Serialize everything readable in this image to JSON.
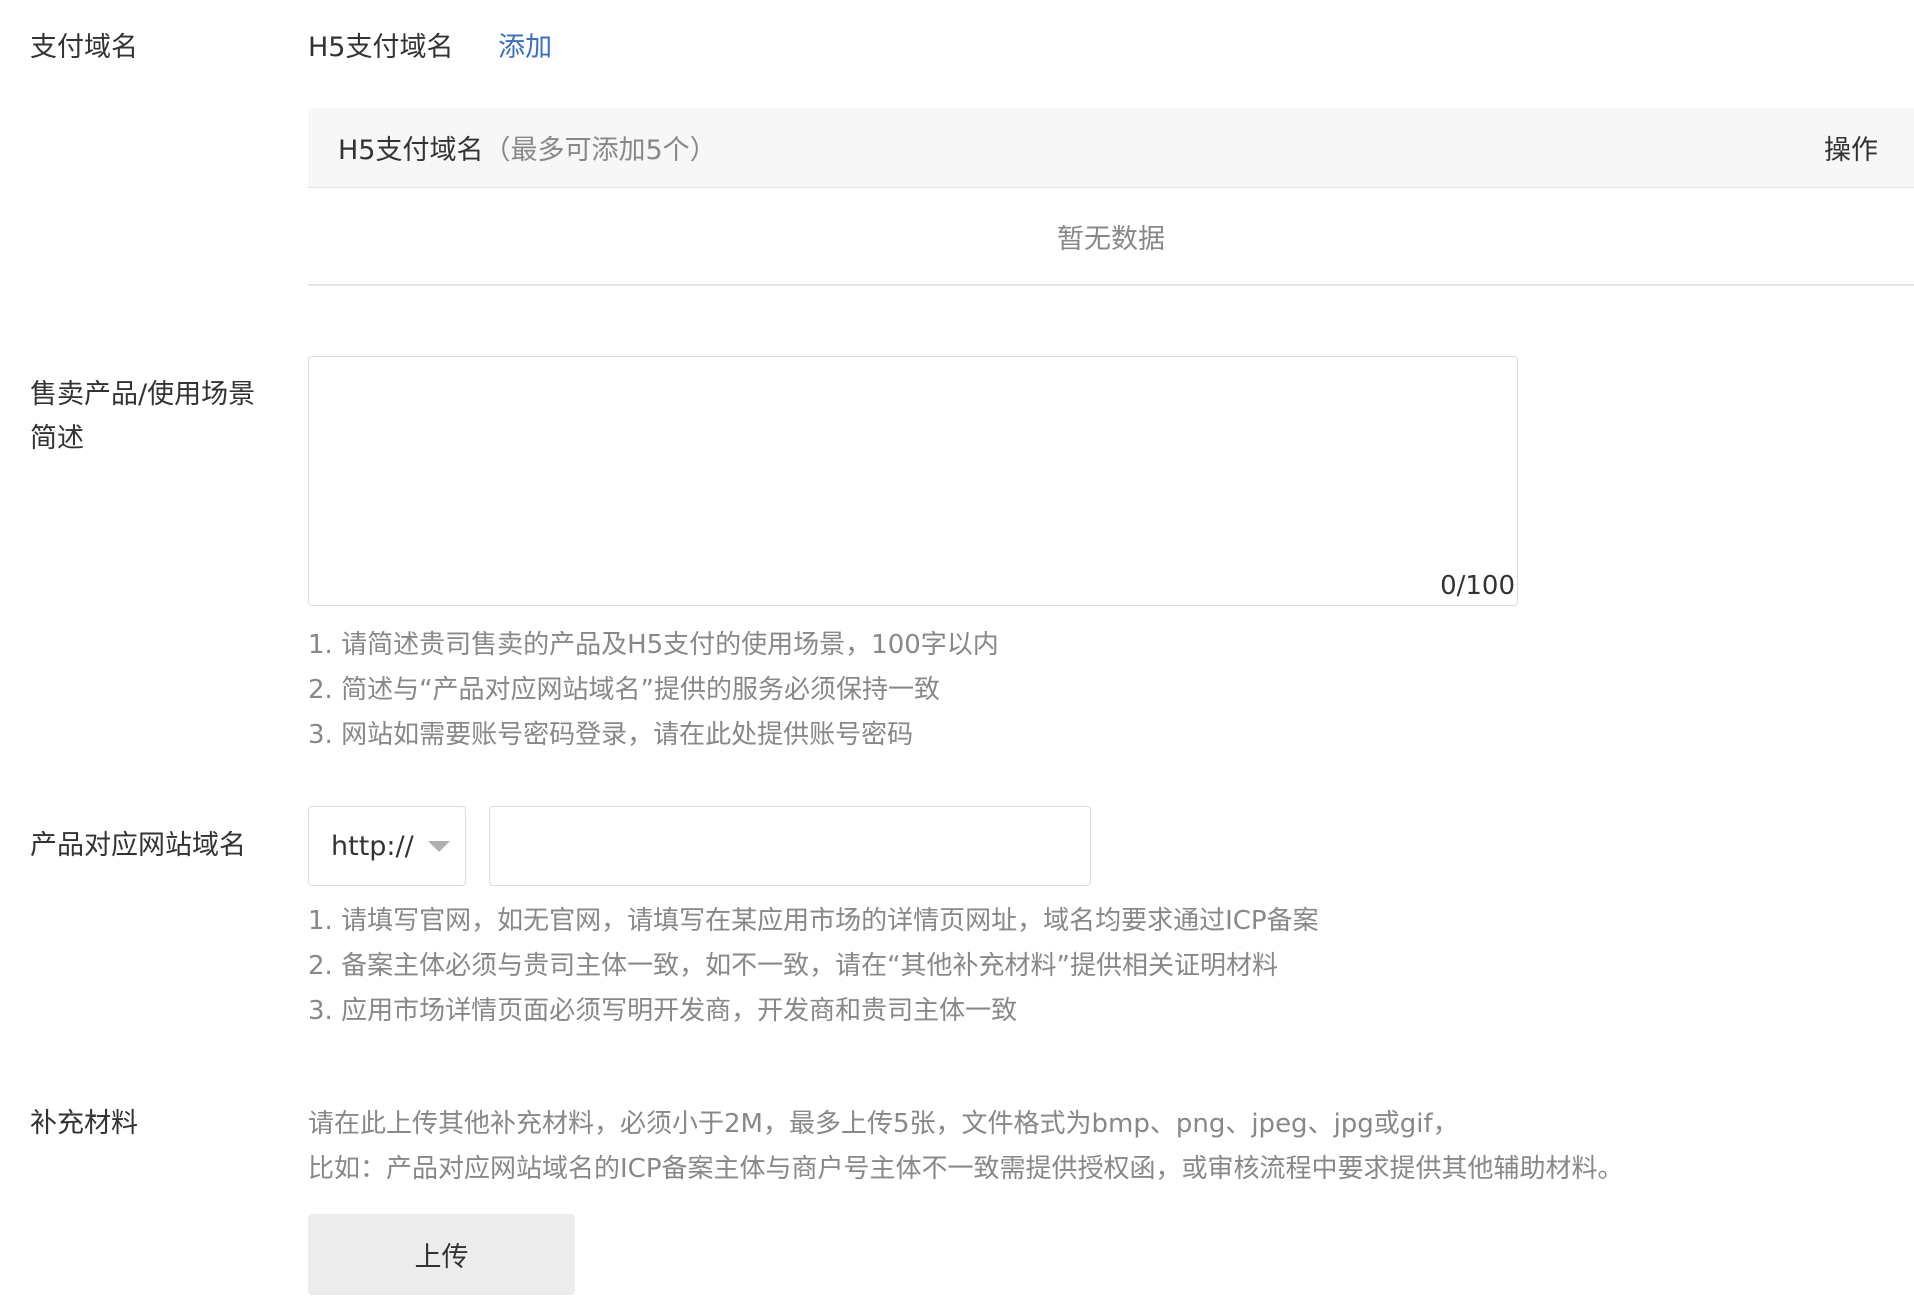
{
  "payment_domain": {
    "label": "支付域名",
    "title": "H5支付域名",
    "add_link": "添加",
    "table": {
      "col_name": "H5支付域名",
      "col_hint": "（最多可添加5个）",
      "col_action": "操作",
      "empty_text": "暂无数据"
    }
  },
  "scene_desc": {
    "label_line1": "售卖产品/使用场景",
    "label_line2": "简述",
    "value": "",
    "counter": "0/100",
    "tips": [
      "1. 请简述贵司售卖的产品及H5支付的使用场景，100字以内",
      "2. 简述与“产品对应网站域名”提供的服务必须保持一致",
      "3. 网站如需要账号密码登录，请在此处提供账号密码"
    ]
  },
  "site_domain": {
    "label": "产品对应网站域名",
    "protocol": "http://",
    "value": "",
    "tips": [
      "1. 请填写官网，如无官网，请填写在某应用市场的详情页网址，域名均要求通过ICP备案",
      "2. 备案主体必须与贵司主体一致，如不一致，请在“其他补充材料”提供相关证明材料",
      "3. 应用市场详情页面必须写明开发商，开发商和贵司主体一致"
    ]
  },
  "extra_material": {
    "label": "补充材料",
    "desc_line1": "请在此上传其他补充材料，必须小于2M，最多上传5张，文件格式为bmp、png、jpeg、jpg或gif，",
    "desc_line2": "比如：产品对应网站域名的ICP备案主体与商户号主体不一致需提供授权函，或审核流程中要求提供其他辅助材料。",
    "upload_label": "上传"
  },
  "colors": {
    "link": "#3a6fc4",
    "muted_text": "#888888",
    "border": "#dcdcdc",
    "header_bg": "#f7f7f7"
  },
  "icons": {
    "protocol_caret": "caret-down-icon"
  }
}
